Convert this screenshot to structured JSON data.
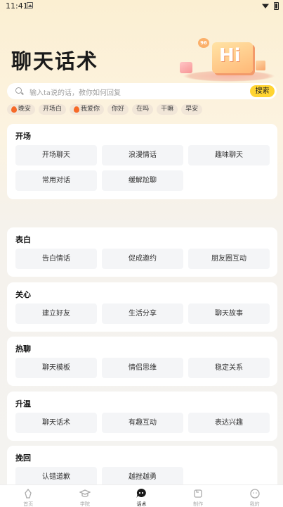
{
  "status": {
    "time": "11:41"
  },
  "header": {
    "title": "聊天话术",
    "hero_text": "Hi",
    "hero_badge": "96"
  },
  "search": {
    "placeholder": "输入ta说的话，教你如何回复",
    "button": "搜索"
  },
  "chips": [
    {
      "label": "晚安",
      "hot": true
    },
    {
      "label": "开场白",
      "hot": false
    },
    {
      "label": "我爱你",
      "hot": true
    },
    {
      "label": "你好",
      "hot": false
    },
    {
      "label": "在吗",
      "hot": false
    },
    {
      "label": "干嘛",
      "hot": false
    },
    {
      "label": "早安",
      "hot": false
    }
  ],
  "sections": [
    {
      "title": "开场",
      "items": [
        "开场聊天",
        "浪漫情话",
        "趣味聊天",
        "常用对话",
        "缓解尬聊"
      ]
    },
    {
      "title": "表白",
      "items": [
        "告白情话",
        "促成邀约",
        "朋友圈互动"
      ]
    },
    {
      "title": "关心",
      "items": [
        "建立好友",
        "生活分享",
        "聊天故事"
      ]
    },
    {
      "title": "热聊",
      "items": [
        "聊天模板",
        "情侣思维",
        "稳定关系"
      ]
    },
    {
      "title": "升温",
      "items": [
        "聊天话术",
        "有趣互动",
        "表达兴趣"
      ]
    },
    {
      "title": "挽回",
      "items": [
        "认错道歉",
        "越挫越勇"
      ]
    }
  ],
  "tabbar": [
    {
      "label": "首页",
      "icon": "home-icon",
      "active": false
    },
    {
      "label": "学院",
      "icon": "graduation-cap-icon",
      "active": false
    },
    {
      "label": "话术",
      "icon": "chat-bubble-icon",
      "active": true
    },
    {
      "label": "制作",
      "icon": "edit-card-icon",
      "active": false
    },
    {
      "label": "我的",
      "icon": "profile-icon",
      "active": false
    }
  ],
  "colors": {
    "accent": "#ffd431",
    "fire": "#f66a28",
    "card": "#ffffff",
    "item_bg": "#f4f5f7"
  }
}
